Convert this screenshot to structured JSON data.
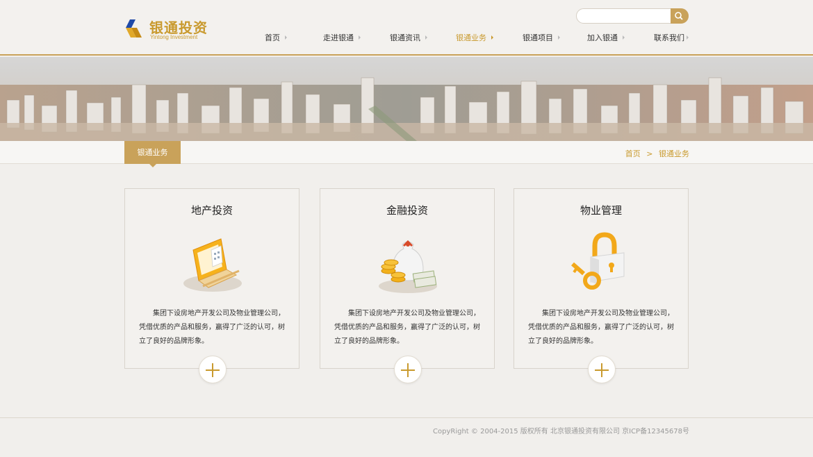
{
  "logo": {
    "cn": "银通投资",
    "en": "Yintong Investment"
  },
  "search": {
    "placeholder": "",
    "button_icon": "search-icon"
  },
  "nav": [
    {
      "label": "首页",
      "active": false
    },
    {
      "label": "走进银通",
      "active": false
    },
    {
      "label": "银通资讯",
      "active": false
    },
    {
      "label": "银通业务",
      "active": true
    },
    {
      "label": "银通项目",
      "active": false
    },
    {
      "label": "加入银通",
      "active": false
    },
    {
      "label": "联系我们",
      "active": false
    }
  ],
  "section_tab": "银通业务",
  "breadcrumb": {
    "home": "首页",
    "sep": ">",
    "current": "银通业务"
  },
  "cards": [
    {
      "title": "地产投资",
      "icon": "laptop-building-icon",
      "desc": "集团下设房地产开发公司及物业管理公司，凭借优质的产品和服务，赢得了广泛的认可，树立了良好的品牌形象。"
    },
    {
      "title": "金融投资",
      "icon": "money-bag-coins-icon",
      "desc": "集团下设房地产开发公司及物业管理公司，凭借优质的产品和服务，赢得了广泛的认可，树立了良好的品牌形象。"
    },
    {
      "title": "物业管理",
      "icon": "padlock-key-icon",
      "desc": "集团下设房地产开发公司及物业管理公司，凭借优质的产品和服务，赢得了广泛的认可，树立了良好的品牌形象。"
    }
  ],
  "footer": {
    "copyright": "CopyRight © 2004-2015 版权所有  北京银通投资有限公司  京ICP备12345678号"
  },
  "colors": {
    "accent": "#c9a25a",
    "gold_text": "#c99a2e",
    "logo_blue": "#1f4aa8"
  }
}
